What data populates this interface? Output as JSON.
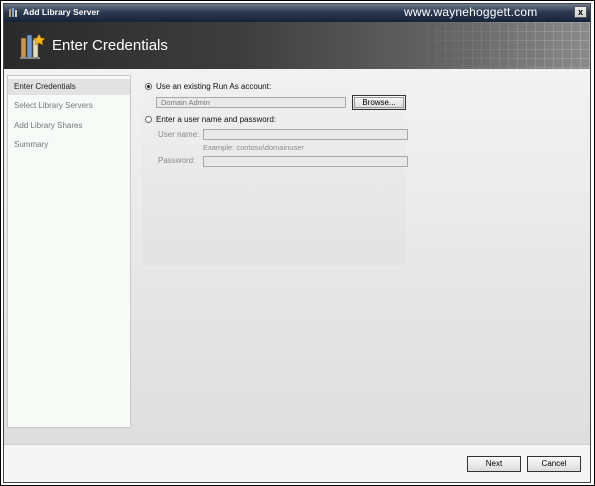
{
  "window": {
    "title": "Add Library Server",
    "watermark": "www.waynehoggett.com",
    "close_label": "x"
  },
  "header": {
    "title": "Enter Credentials"
  },
  "sidebar": {
    "items": [
      {
        "label": "Enter Credentials",
        "active": true
      },
      {
        "label": "Select Library Servers",
        "active": false
      },
      {
        "label": "Add Library Shares",
        "active": false
      },
      {
        "label": "Summary",
        "active": false
      }
    ]
  },
  "credentials": {
    "existing_option_label": "Use an existing Run As account:",
    "existing_account_value": "Domain Admin",
    "browse_label": "Browse...",
    "manual_option_label": "Enter a user name and password:",
    "username_label": "User name:",
    "username_value": "",
    "username_hint": "Example: contoso\\domainuser",
    "password_label": "Password:",
    "password_value": "",
    "selected_option": "existing"
  },
  "footer": {
    "next_label": "Next",
    "cancel_label": "Cancel"
  }
}
